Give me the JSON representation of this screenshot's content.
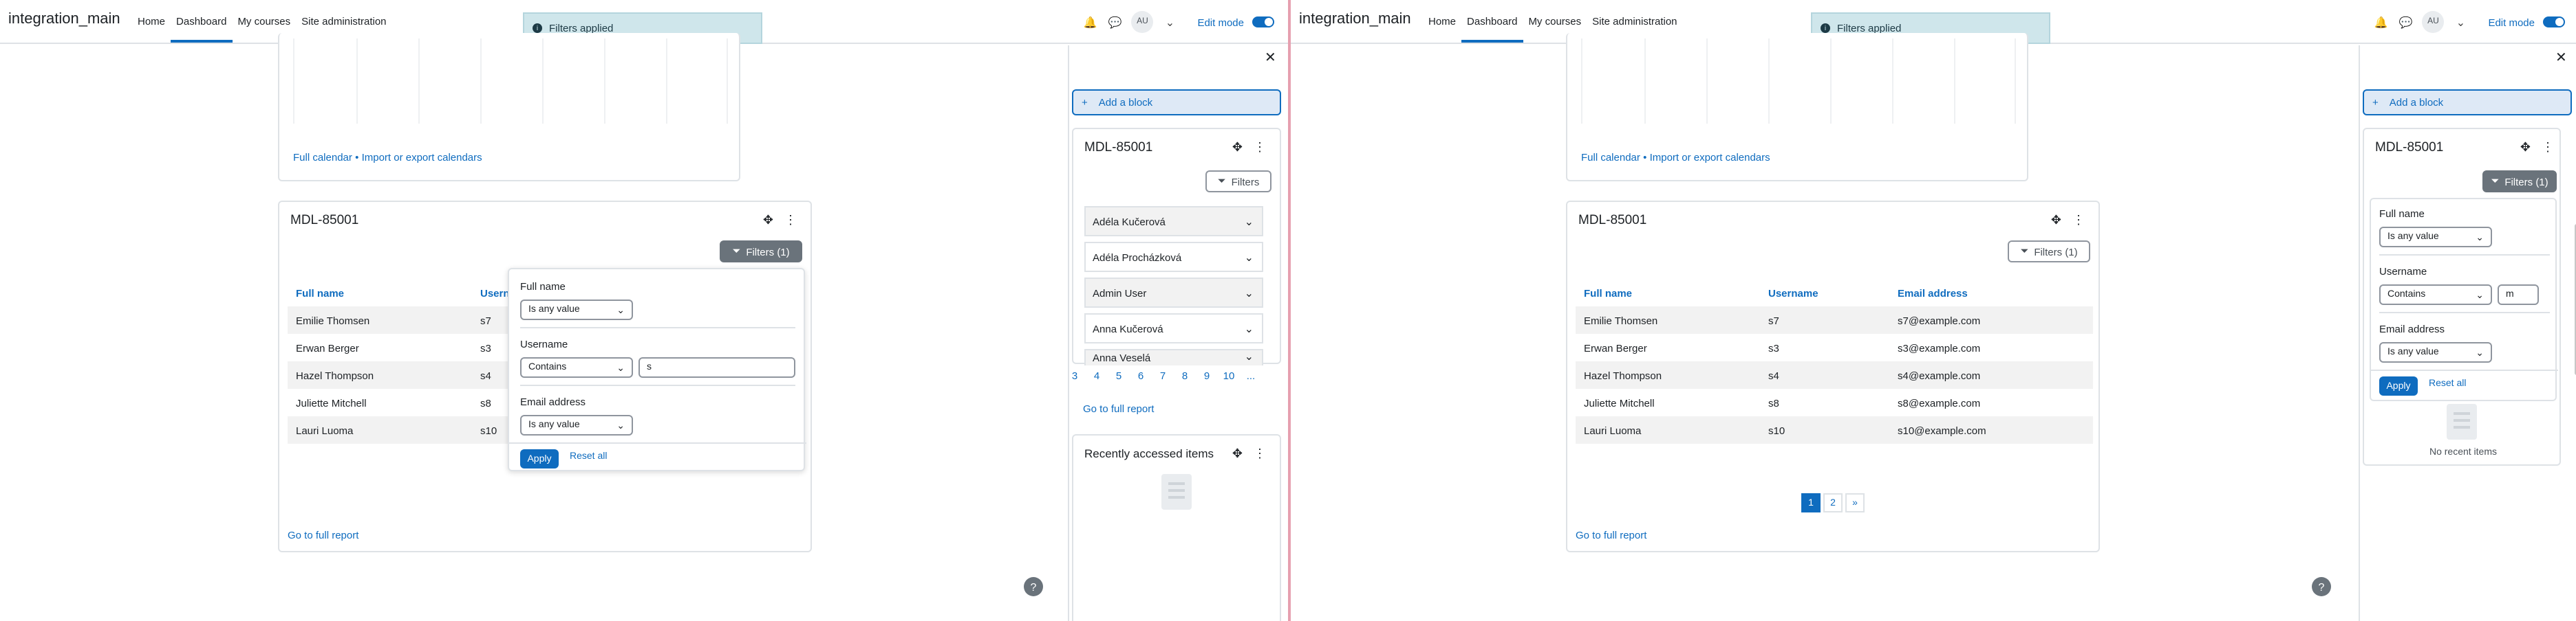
{
  "nav": {
    "site_name": "integration_main",
    "links": [
      "Home",
      "Dashboard",
      "My courses",
      "Site administration"
    ],
    "avatar_initials": "AU",
    "edit_mode_label": "Edit mode"
  },
  "toast": {
    "message": "Filters applied"
  },
  "calendar": {
    "full_calendar_link": "Full calendar",
    "separator": "•",
    "import_export_link": "Import or export calendars"
  },
  "report": {
    "title": "MDL-85001",
    "filters_button": "Filters (1)",
    "columns": [
      "Full name",
      "Username",
      "Email address"
    ],
    "rows": [
      {
        "fullname": "Emilie Thomsen",
        "username": "s7",
        "email": "s7@example.com"
      },
      {
        "fullname": "Erwan Berger",
        "username": "s3",
        "email": "s3@example.com"
      },
      {
        "fullname": "Hazel Thompson",
        "username": "s4",
        "email": "s4@example.com"
      },
      {
        "fullname": "Juliette Mitchell",
        "username": "s8",
        "email": "s8@example.com"
      },
      {
        "fullname": "Lauri Luoma",
        "username": "s10",
        "email": "s10@example.com"
      }
    ],
    "left_username_header": "Usern",
    "go_to_full_report": "Go to full report",
    "pages": [
      "1",
      "2",
      "»"
    ]
  },
  "filters_left": {
    "fullname_label": "Full name",
    "fullname_op": "Is any value",
    "username_label": "Username",
    "username_op": "Contains",
    "username_value": "s",
    "email_label": "Email address",
    "email_op": "Is any value",
    "apply": "Apply",
    "reset": "Reset all"
  },
  "drawer": {
    "add_block": "Add a block",
    "block_title": "MDL-85001",
    "filters_button_plain": "Filters",
    "filters_button_active": "Filters (1)",
    "cards": [
      "Adéla Kučerová",
      "Adéla Procházková",
      "Admin User",
      "Anna Kučerová",
      "Anna Veselá"
    ],
    "pager": [
      "3",
      "4",
      "5",
      "6",
      "7",
      "8",
      "9",
      "10",
      "..."
    ],
    "go_to_full_report": "Go to full report",
    "recent_title": "Recently accessed items",
    "no_recent": "No recent items"
  },
  "filters_right": {
    "fullname_label": "Full name",
    "fullname_op": "Is any value",
    "username_label": "Username",
    "username_op": "Contains",
    "username_value": "m",
    "email_label": "Email address",
    "email_op": "Is any value",
    "apply": "Apply",
    "reset": "Reset all"
  },
  "help_icon": "?",
  "colors": {
    "accent": "#0f6cbf",
    "toast_bg": "#cfe6eb",
    "filter_active": "#6a737b"
  }
}
